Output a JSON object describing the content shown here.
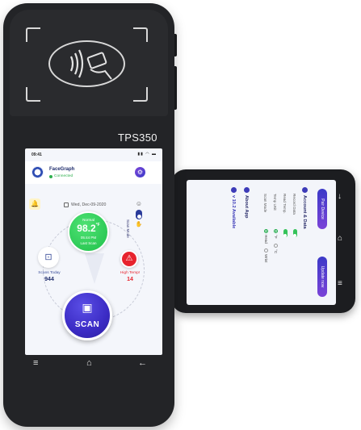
{
  "device": {
    "model": "TPS350"
  },
  "status_bar": {
    "time": "09:41",
    "icons": "▮▮ ◠ ▬"
  },
  "app": {
    "name": "FaceGraph",
    "connection_status": "Connected",
    "date": "Wed, Dec-09-2020",
    "scan_mode_label": "Scan Mode"
  },
  "temperature": {
    "status": "Normal",
    "value": "98.2",
    "unit": "°F",
    "time": "05:44 PM",
    "caption": "Last Scan"
  },
  "scans_today": {
    "label": "Scans Today",
    "count": "944"
  },
  "high_temp": {
    "label": "High Temp!",
    "count": "14"
  },
  "scan_button": {
    "label": "SCAN"
  },
  "back_phone": {
    "pair_label": "Pair Device",
    "update_label": "Update now",
    "account_heading": "Account & Data",
    "rows": [
      "Record Data",
      "Read Temp.",
      "Temp Unit",
      "Scan Mode"
    ],
    "unit_options": [
      "°F",
      "°C"
    ],
    "mode_options": [
      "Head",
      "Wrist"
    ],
    "about_heading": "About App",
    "version": "v 10.2 Available"
  },
  "icons": {
    "nfc": "nfc-tap-icon",
    "settings": "gear-icon",
    "bell": "bell-icon",
    "scans": "scan-count-icon",
    "alert": "warning-icon",
    "scan": "face-scan-icon"
  },
  "colors": {
    "accent": "#3b2bc4",
    "normal": "#1fc04a",
    "alert": "#e7232d",
    "brand": "#1e2c6c"
  }
}
